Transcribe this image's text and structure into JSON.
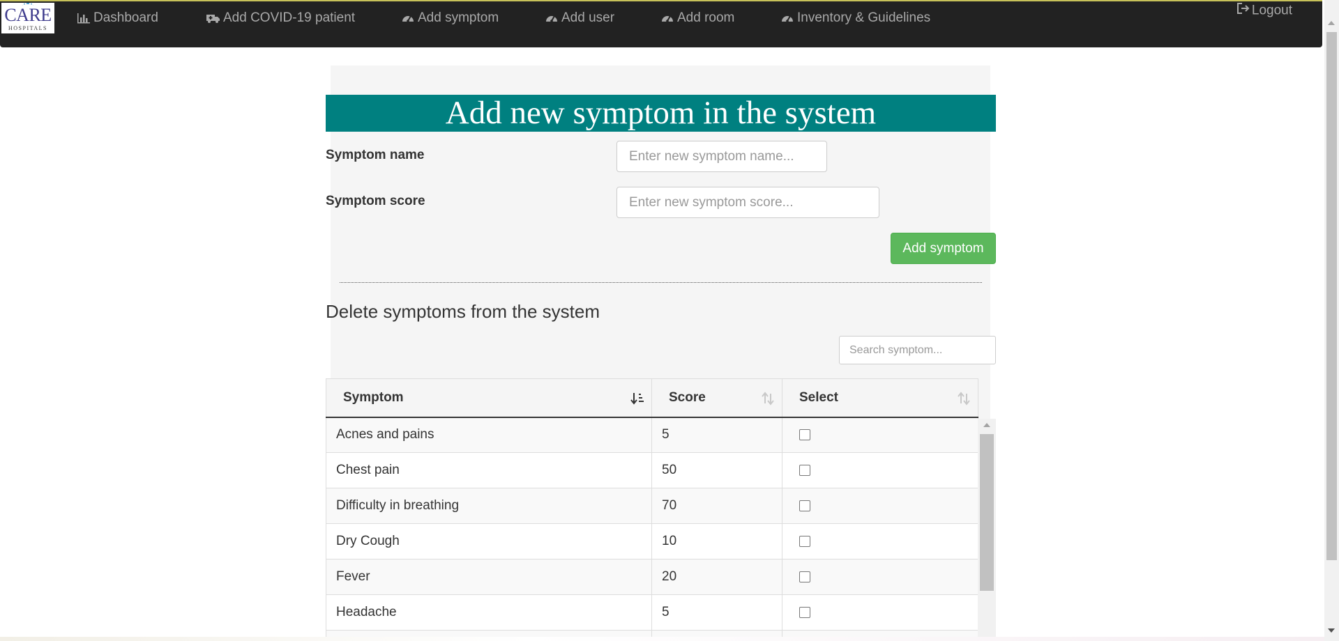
{
  "brand": {
    "logo_main": "CARE",
    "logo_sub": "HOSPITALS"
  },
  "nav": {
    "items": [
      {
        "label": "Dashboard",
        "icon": "bar-chart-icon"
      },
      {
        "label": "Add COVID-19 patient",
        "icon": "ambulance-icon"
      },
      {
        "label": "Add symptom",
        "icon": "dashboard-icon"
      },
      {
        "label": "Add user",
        "icon": "dashboard-icon"
      },
      {
        "label": "Add room",
        "icon": "dashboard-icon"
      },
      {
        "label": "Inventory & Guidelines",
        "icon": "dashboard-icon"
      }
    ],
    "logout": "Logout"
  },
  "form": {
    "title": "Add new symptom in the system",
    "name_label": "Symptom name",
    "name_placeholder": "Enter new symptom name...",
    "score_label": "Symptom score",
    "score_placeholder": "Enter new symptom score...",
    "submit_label": "Add symptom"
  },
  "delete_section": {
    "title": "Delete symptoms from the system",
    "search_placeholder": "Search symptom...",
    "columns": [
      "Symptom",
      "Score",
      "Select"
    ],
    "rows": [
      {
        "symptom": "Acnes and pains",
        "score": "5",
        "selected": false
      },
      {
        "symptom": "Chest pain",
        "score": "50",
        "selected": false
      },
      {
        "symptom": "Difficulty in breathing",
        "score": "70",
        "selected": false
      },
      {
        "symptom": "Dry Cough",
        "score": "10",
        "selected": false
      },
      {
        "symptom": "Fever",
        "score": "20",
        "selected": false
      },
      {
        "symptom": "Headache",
        "score": "5",
        "selected": false
      }
    ]
  },
  "colors": {
    "navbar_bg": "#222222",
    "banner_bg": "#008080",
    "button_green": "#5cb85c",
    "panel_bg": "#f5f5f5"
  }
}
